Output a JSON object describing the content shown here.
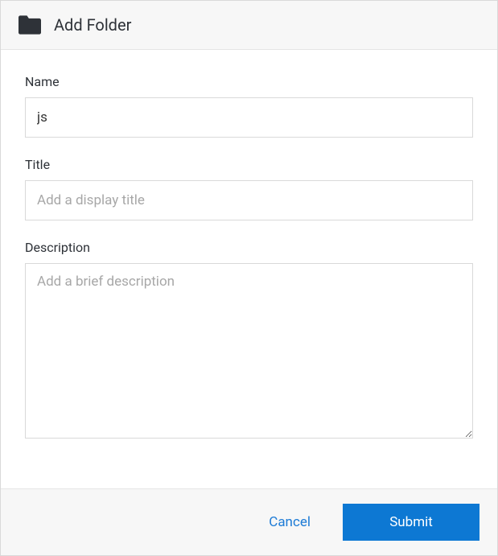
{
  "header": {
    "title": "Add Folder"
  },
  "form": {
    "name_label": "Name",
    "name_value": "js",
    "title_label": "Title",
    "title_placeholder": "Add a display title",
    "title_value": "",
    "description_label": "Description",
    "description_placeholder": "Add a brief description",
    "description_value": ""
  },
  "footer": {
    "cancel_label": "Cancel",
    "submit_label": "Submit"
  },
  "colors": {
    "primary": "#0d78d3",
    "link": "#1d7bd6",
    "border": "#d9d9d9",
    "header_bg": "#f7f7f7"
  }
}
